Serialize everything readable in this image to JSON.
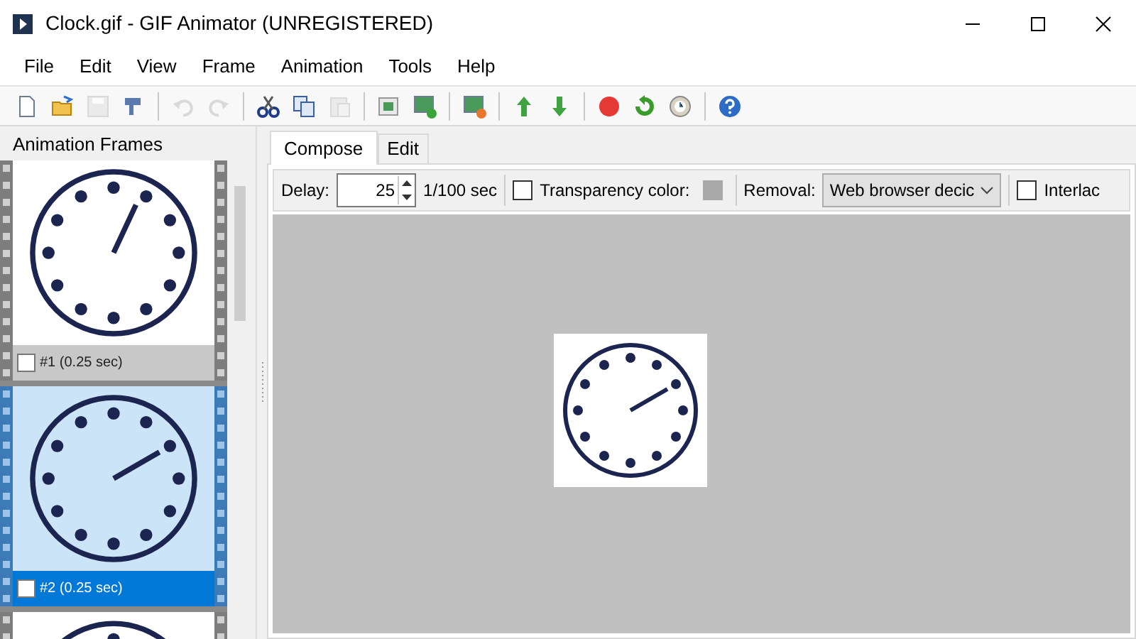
{
  "window": {
    "title": "Clock.gif - GIF Animator (UNREGISTERED)"
  },
  "menu": [
    "File",
    "Edit",
    "View",
    "Frame",
    "Animation",
    "Tools",
    "Help"
  ],
  "toolbar": [
    {
      "kind": "new",
      "disabled": false
    },
    {
      "kind": "open",
      "disabled": false
    },
    {
      "kind": "save",
      "disabled": true
    },
    {
      "kind": "optimize",
      "disabled": false
    },
    {
      "kind": "sep"
    },
    {
      "kind": "undo",
      "disabled": true
    },
    {
      "kind": "redo",
      "disabled": true
    },
    {
      "kind": "sep"
    },
    {
      "kind": "cut",
      "disabled": false
    },
    {
      "kind": "copy",
      "disabled": false
    },
    {
      "kind": "paste",
      "disabled": true
    },
    {
      "kind": "sep"
    },
    {
      "kind": "frame",
      "disabled": false
    },
    {
      "kind": "addframe",
      "disabled": false
    },
    {
      "kind": "sep"
    },
    {
      "kind": "delframe",
      "disabled": false
    },
    {
      "kind": "sep"
    },
    {
      "kind": "up",
      "disabled": false
    },
    {
      "kind": "down",
      "disabled": false
    },
    {
      "kind": "sep"
    },
    {
      "kind": "record",
      "disabled": false
    },
    {
      "kind": "loop",
      "disabled": false
    },
    {
      "kind": "timer",
      "disabled": false
    },
    {
      "kind": "sep"
    },
    {
      "kind": "help",
      "disabled": false
    }
  ],
  "frames_panel": {
    "title": "Animation Frames",
    "frames": [
      {
        "label": "#1 (0.25 sec)",
        "checked": false,
        "selected": false
      },
      {
        "label": "#2 (0.25 sec)",
        "checked": false,
        "selected": true
      }
    ]
  },
  "tabs": [
    {
      "label": "Compose",
      "selected": true
    },
    {
      "label": "Edit",
      "selected": false
    }
  ],
  "options": {
    "delay_label": "Delay:",
    "delay_value": "25",
    "delay_unit": "1/100 sec",
    "transparency": {
      "label": "Transparency color:",
      "checked": false
    },
    "removal_label": "Removal:",
    "removal_value": "Web browser decic",
    "interlace": {
      "label": "Interlac",
      "checked": false
    }
  }
}
